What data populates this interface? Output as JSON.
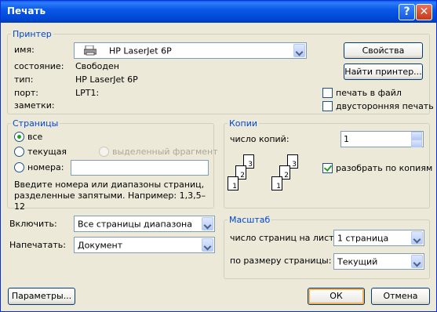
{
  "window": {
    "title": "Печать"
  },
  "printer": {
    "legend": "Принтер",
    "name_label": "имя:",
    "name_value": "HP LaserJet 6P",
    "status_label": "состояние:",
    "status_value": "Свободен",
    "type_label": "тип:",
    "type_value": "HP LaserJet 6P",
    "port_label": "порт:",
    "port_value": "LPT1:",
    "notes_label": "заметки:",
    "properties_button": "Свойства",
    "find_button": "Найти принтер...",
    "print_to_file": "печать в файл",
    "duplex": "двусторонняя печать"
  },
  "pages": {
    "legend": "Страницы",
    "all": "все",
    "current": "текущая",
    "selection": "выделенный фрагмент",
    "numbers": "номера:",
    "numbers_value": "",
    "hint": "Введите номера или диапазоны страниц, разделенные запятыми. Например: 1,3,5–12"
  },
  "copies": {
    "legend": "Копии",
    "count_label": "число копий:",
    "count_value": "1",
    "collate": "разобрать по копиям",
    "page_numbers": [
      "1",
      "2",
      "3"
    ]
  },
  "include": {
    "label": "Включить:",
    "value": "Все страницы диапазона"
  },
  "print_what": {
    "label": "Напечатать:",
    "value": "Документ"
  },
  "scale": {
    "legend": "Масштаб",
    "pages_per_sheet_label": "число страниц на листе:",
    "pages_per_sheet_value": "1 страница",
    "fit_label": "по размеру страницы:",
    "fit_value": "Текущий"
  },
  "footer": {
    "options": "Параметры...",
    "ok": "ОК",
    "cancel": "Отмена"
  },
  "colors": {
    "titlebar": "#0a58e8",
    "accent": "#0046d5",
    "check": "#21a121"
  }
}
